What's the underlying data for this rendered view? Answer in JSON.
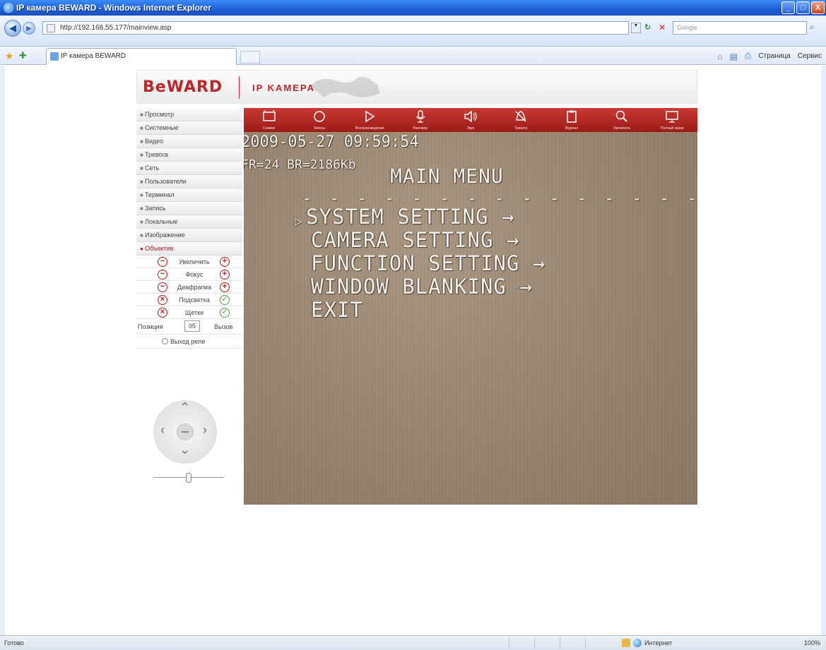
{
  "window": {
    "title": "IP камера BEWARD - Windows Internet Explorer",
    "min_label": "_",
    "max_label": "□",
    "close_label": "X"
  },
  "browser": {
    "url": "http://192.168.55.177/mainview.asp",
    "search_placeholder": "Google",
    "tab_title": "IP камера BEWARD",
    "page_menu": "Страница",
    "tools_menu": "Сервис",
    "back_glyph": "◀",
    "forward_glyph": "▶",
    "refresh_glyph": "↻",
    "stop_glyph": "✕",
    "search_glyph": "⌕"
  },
  "header": {
    "logo": "BeWARD",
    "title": "IP KAMEPA"
  },
  "sidebar": {
    "items": [
      {
        "label": "Просмотр"
      },
      {
        "label": "Системные"
      },
      {
        "label": "Видео"
      },
      {
        "label": "Тревога"
      },
      {
        "label": "Сеть"
      },
      {
        "label": "Пользователи"
      },
      {
        "label": "Терминал"
      },
      {
        "label": "Запись"
      },
      {
        "label": "Локальные"
      },
      {
        "label": "Изображение"
      },
      {
        "label": "Объектив"
      }
    ],
    "lens": [
      {
        "label": "Увеличить"
      },
      {
        "label": "Фокус"
      },
      {
        "label": "Диафрагма"
      },
      {
        "label": "Подсветка"
      },
      {
        "label": "Щетки"
      }
    ],
    "position_label": "Позиция",
    "position_value": "95",
    "call_label": "Вызов",
    "relay_label": "Выход реле"
  },
  "toolbar": {
    "items": [
      {
        "label": "Снимок",
        "icon": "snapshot-icon"
      },
      {
        "label": "Запись",
        "icon": "record-icon"
      },
      {
        "label": "Воспроизведение",
        "icon": "play-icon"
      },
      {
        "label": "Разговор",
        "icon": "microphone-icon"
      },
      {
        "label": "Звук",
        "icon": "speaker-icon"
      },
      {
        "label": "Тревога",
        "icon": "alarm-icon"
      },
      {
        "label": "Журнал",
        "icon": "log-icon"
      },
      {
        "label": "Увеличить",
        "icon": "zoom-icon"
      },
      {
        "label": "Полный экран",
        "icon": "fullscreen-icon"
      }
    ]
  },
  "video": {
    "timestamp": "2009-05-27 09:59:54",
    "stats": "FR=24 BR=2186Kb",
    "menu_title": "MAIN MENU",
    "separator": "- - - - - - - - - - - - - - - - - - - - - - -",
    "cursor": "▷",
    "menu_items": [
      {
        "label": "SYSTEM SETTING →"
      },
      {
        "label": "CAMERA SETTING →"
      },
      {
        "label": "FUNCTION SETTING →"
      },
      {
        "label": "WINDOW BLANKING →"
      },
      {
        "label": "EXIT"
      }
    ]
  },
  "status": {
    "ready": "Готово",
    "zone": "Интернет",
    "zoom": "100%"
  },
  "colors": {
    "accent": "#c0252a",
    "toolbar": "#b32b26"
  }
}
